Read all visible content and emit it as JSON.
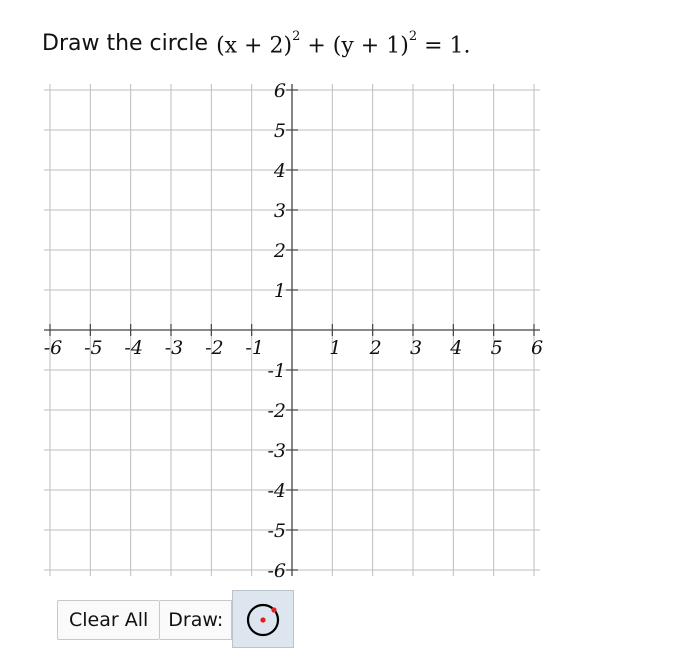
{
  "question": {
    "prompt": "Draw the circle",
    "equation": {
      "part1": "(x + 2)",
      "exp1": "2",
      "plus": "+",
      "part2": "(y + 1)",
      "exp2": "2",
      "rhs": "= 1."
    }
  },
  "graph": {
    "x_range": [
      -6,
      6
    ],
    "y_range": [
      -6,
      6
    ],
    "grid": true,
    "x_tick_labels": [
      "-6",
      "-5",
      "-4",
      "-3",
      "-2",
      "-1",
      "1",
      "2",
      "3",
      "4",
      "5",
      "6"
    ],
    "y_tick_labels": [
      "6",
      "5",
      "4",
      "3",
      "2",
      "1",
      "-1",
      "-2",
      "-3",
      "-4",
      "-5",
      "-6"
    ],
    "line_color": "#444444",
    "grid_color": "#bdbdbd"
  },
  "toolbar": {
    "clear_label": "Clear All",
    "draw_label": "Draw:",
    "tool_icon": "circle-tool-icon",
    "tool_ring_color": "#000000",
    "tool_point_color": "#e02020"
  }
}
